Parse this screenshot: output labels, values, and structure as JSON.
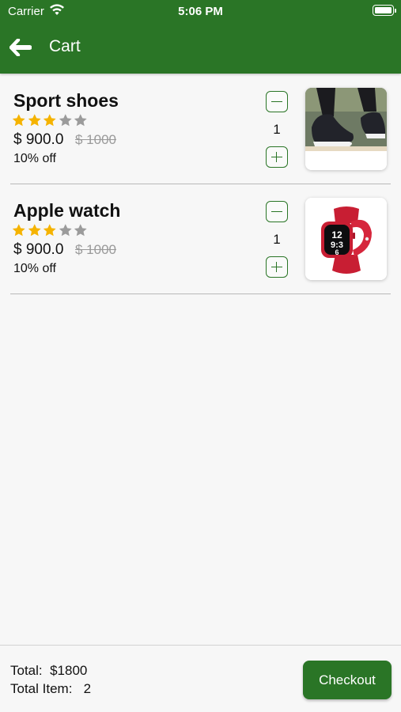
{
  "status_bar": {
    "carrier": "Carrier",
    "time": "5:06 PM"
  },
  "header": {
    "title": "Cart"
  },
  "colors": {
    "primary": "#2a7526",
    "star_filled": "#f5b300",
    "star_empty": "#9b9b9b"
  },
  "cart": {
    "items": [
      {
        "name": "Sport shoes",
        "rating": 3,
        "max_rating": 5,
        "price": "$ 900.0",
        "original_price": "$ 1000",
        "discount": "10% off",
        "quantity": "1",
        "image_icon": "sneaker-image"
      },
      {
        "name": "Apple watch",
        "rating": 3,
        "max_rating": 5,
        "price": "$ 900.0",
        "original_price": "$ 1000",
        "discount": "10% off",
        "quantity": "1",
        "image_icon": "watch-image"
      }
    ]
  },
  "footer": {
    "total_label": "Total:",
    "total_value": "$1800",
    "items_label": "Total Item:",
    "items_value": "2",
    "checkout_label": "Checkout"
  }
}
